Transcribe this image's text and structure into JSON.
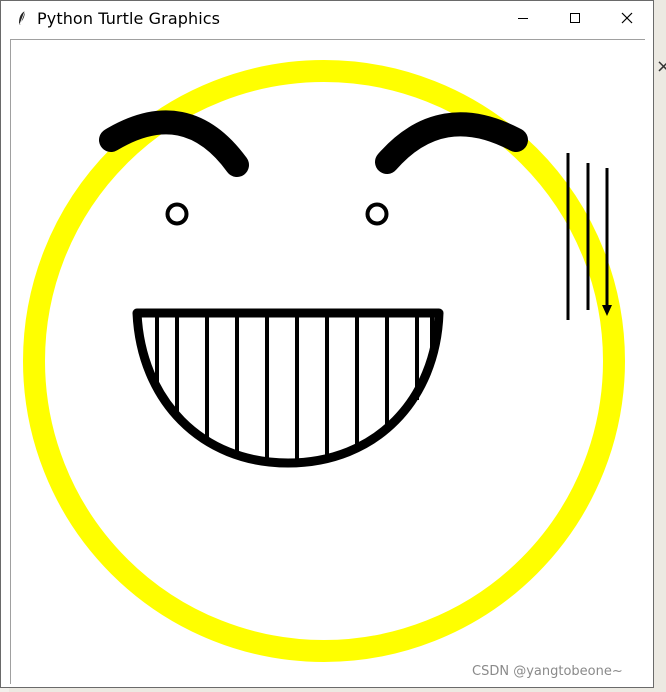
{
  "window": {
    "title": "Python Turtle Graphics"
  },
  "icons": {
    "app": "feather-icon",
    "minimize": "minimize-icon",
    "maximize": "maximize-icon",
    "close": "close-icon"
  },
  "colors": {
    "face_ring": "#ffff00",
    "ink": "#000000",
    "canvas": "#ffffff"
  },
  "watermark": "CSDN @yangtobeone~"
}
